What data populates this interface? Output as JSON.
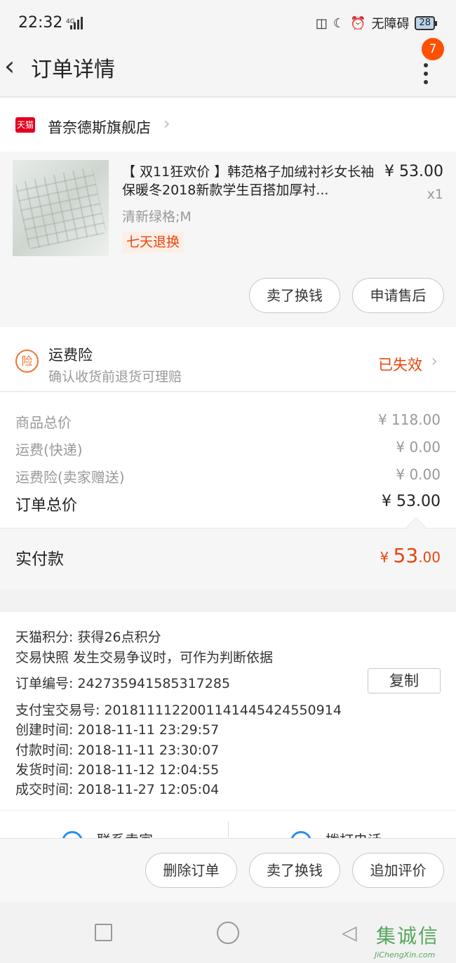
{
  "status_bar": {
    "time": "22:32",
    "network": "4G",
    "accessibility": "无障碍",
    "battery": "28"
  },
  "nav": {
    "title": "订单详情",
    "badge": "7"
  },
  "shop": {
    "platform_logo": "天猫",
    "name": "普奈德斯旗舰店"
  },
  "product": {
    "title": "【 双11狂欢价 】韩范格子加绒衬衫女长袖保暖冬2018新款学生百搭加厚衬...",
    "price": "¥ 53.00",
    "quantity": "x1",
    "sku": "清新绿格;M",
    "tag": "七天退换",
    "buttons": [
      "卖了换钱",
      "申请售后"
    ]
  },
  "insurance": {
    "icon_text": "险",
    "title": "运费险",
    "subtitle": "确认收货前退货可理赔",
    "status": "已失效"
  },
  "summary": {
    "rows": [
      {
        "label": "商品总价",
        "value": "¥ 118.00"
      },
      {
        "label": "运费(快递)",
        "value": "¥ 0.00"
      },
      {
        "label": "运费险(卖家赠送)",
        "value": "¥ 0.00"
      }
    ],
    "total_label": "订单总价",
    "total_value": "¥ 53.00"
  },
  "payment": {
    "label": "实付款",
    "currency": "¥ ",
    "integer": "53",
    "decimal": ".00"
  },
  "order_info": {
    "points": "天猫积分:   获得26点积分",
    "snapshot": "交易快照    发生交易争议时，可作为判断依据",
    "order_no": "订单编号:   242735941585317285",
    "copy_label": "复制",
    "alipay_no": "支付宝交易号:   2018111122001141445424550914",
    "created": "创建时间:   2018-11-11 23:29:57",
    "paid": "付款时间:   2018-11-11 23:30:07",
    "shipped": "发货时间:   2018-11-12 12:04:55",
    "completed": "成交时间:   2018-11-27 12:05:04"
  },
  "contact": {
    "seller": "联系卖家",
    "phone": "拨打电话"
  },
  "actions": [
    "删除订单",
    "卖了换钱",
    "追加评价"
  ],
  "watermark": {
    "cn": "集诚信",
    "en": "JiChengXin.com"
  },
  "colors": {
    "accent": "#e8450d",
    "badge": "#ff5000",
    "tmall_red": "#e4001e",
    "contact_blue": "#2a8fe6"
  }
}
